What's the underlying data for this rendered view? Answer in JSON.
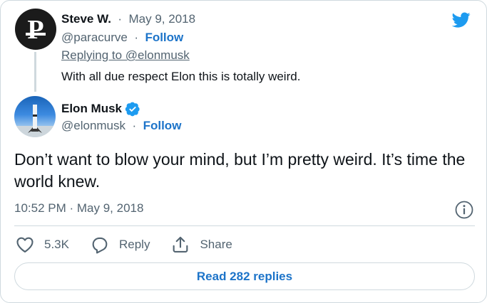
{
  "parent_tweet": {
    "name": "Steve W.",
    "separator": "·",
    "date": "May 9, 2018",
    "handle": "@paracurve",
    "follow_sep": "·",
    "follow_label": "Follow",
    "replying_to": "Replying to @elonmusk",
    "text": "With all due respect Elon this is totally weird.",
    "avatar_letter": "P"
  },
  "main_tweet": {
    "name": "Elon Musk",
    "handle": "@elonmusk",
    "follow_sep": "·",
    "follow_label": "Follow",
    "text": "Don’t want to blow your mind, but I’m pretty weird. It’s time the world knew.",
    "timestamp": "10:52 PM · May 9, 2018"
  },
  "actions": {
    "likes": "5.3K",
    "reply_label": "Reply",
    "share_label": "Share"
  },
  "read_replies_label": "Read 282 replies",
  "icons": [
    "twitter-logo-icon",
    "verified-badge-icon",
    "info-icon",
    "heart-icon",
    "reply-icon",
    "share-icon"
  ],
  "colors": {
    "brand": "#1d9bf0",
    "link": "#1d74c9",
    "muted": "#536471",
    "border": "#cfd9de"
  }
}
